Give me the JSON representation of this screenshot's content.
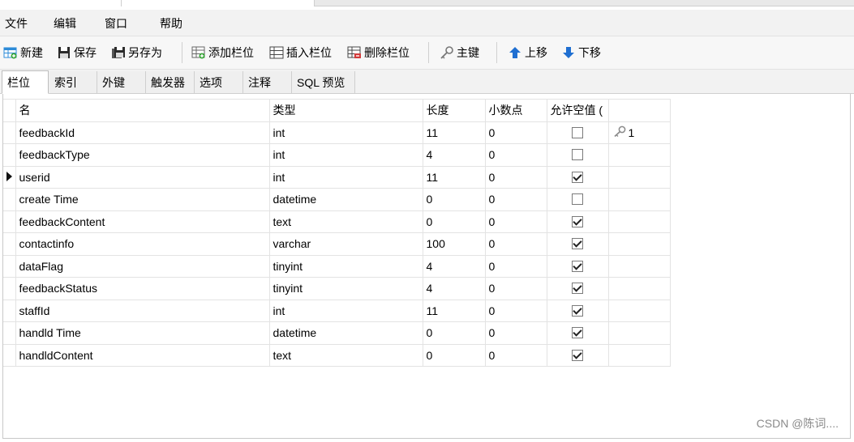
{
  "menu": [
    "文件",
    "编辑",
    "窗口",
    "帮助"
  ],
  "toolbar": {
    "new": "新建",
    "save": "保存",
    "save_as": "另存为",
    "add_field": "添加栏位",
    "insert_field": "插入栏位",
    "delete_field": "删除栏位",
    "primary_key": "主键",
    "move_up": "上移",
    "move_down": "下移"
  },
  "tabs": [
    "栏位",
    "索引",
    "外键",
    "触发器",
    "选项",
    "注释",
    "SQL 预览"
  ],
  "active_tab": "栏位",
  "columns": {
    "name": "名",
    "type": "类型",
    "length": "长度",
    "decimals": "小数点",
    "allow_null": "允许空值 ("
  },
  "fields": [
    {
      "name": "feedbackId",
      "type": "int",
      "length": "11",
      "decimals": "0",
      "allow_null": false,
      "key": "1"
    },
    {
      "name": "feedbackType",
      "type": "int",
      "length": "4",
      "decimals": "0",
      "allow_null": false,
      "key": ""
    },
    {
      "name": "userid",
      "type": "int",
      "length": "11",
      "decimals": "0",
      "allow_null": true,
      "key": "",
      "current": true
    },
    {
      "name": "create Time",
      "type": "datetime",
      "length": "0",
      "decimals": "0",
      "allow_null": false,
      "key": ""
    },
    {
      "name": "feedbackContent",
      "type": "text",
      "length": "0",
      "decimals": "0",
      "allow_null": true,
      "key": ""
    },
    {
      "name": "contactinfo",
      "type": "varchar",
      "length": "100",
      "decimals": "0",
      "allow_null": true,
      "key": ""
    },
    {
      "name": "dataFlag",
      "type": "tinyint",
      "length": "4",
      "decimals": "0",
      "allow_null": true,
      "key": ""
    },
    {
      "name": "feedbackStatus",
      "type": "tinyint",
      "length": "4",
      "decimals": "0",
      "allow_null": true,
      "key": ""
    },
    {
      "name": "staffId",
      "type": "int",
      "length": "11",
      "decimals": "0",
      "allow_null": true,
      "key": ""
    },
    {
      "name": "handld Time",
      "type": "datetime",
      "length": "0",
      "decimals": "0",
      "allow_null": true,
      "key": ""
    },
    {
      "name": "handldContent",
      "type": "text",
      "length": "0",
      "decimals": "0",
      "allow_null": true,
      "key": ""
    }
  ],
  "watermark": "CSDN @陈词....",
  "icons": {
    "new": "new-table-icon",
    "save": "floppy-icon",
    "save_as": "floppy-stack-icon",
    "add_field": "add-field-icon",
    "insert_field": "insert-field-icon",
    "delete_field": "delete-field-icon",
    "primary_key": "key-icon",
    "move_up": "arrow-up-icon",
    "move_down": "arrow-down-icon"
  },
  "colors": {
    "move_arrows": "#1f6fd1",
    "new_icon": "#2d8bd8",
    "delete_icon": "#d23b3b"
  }
}
